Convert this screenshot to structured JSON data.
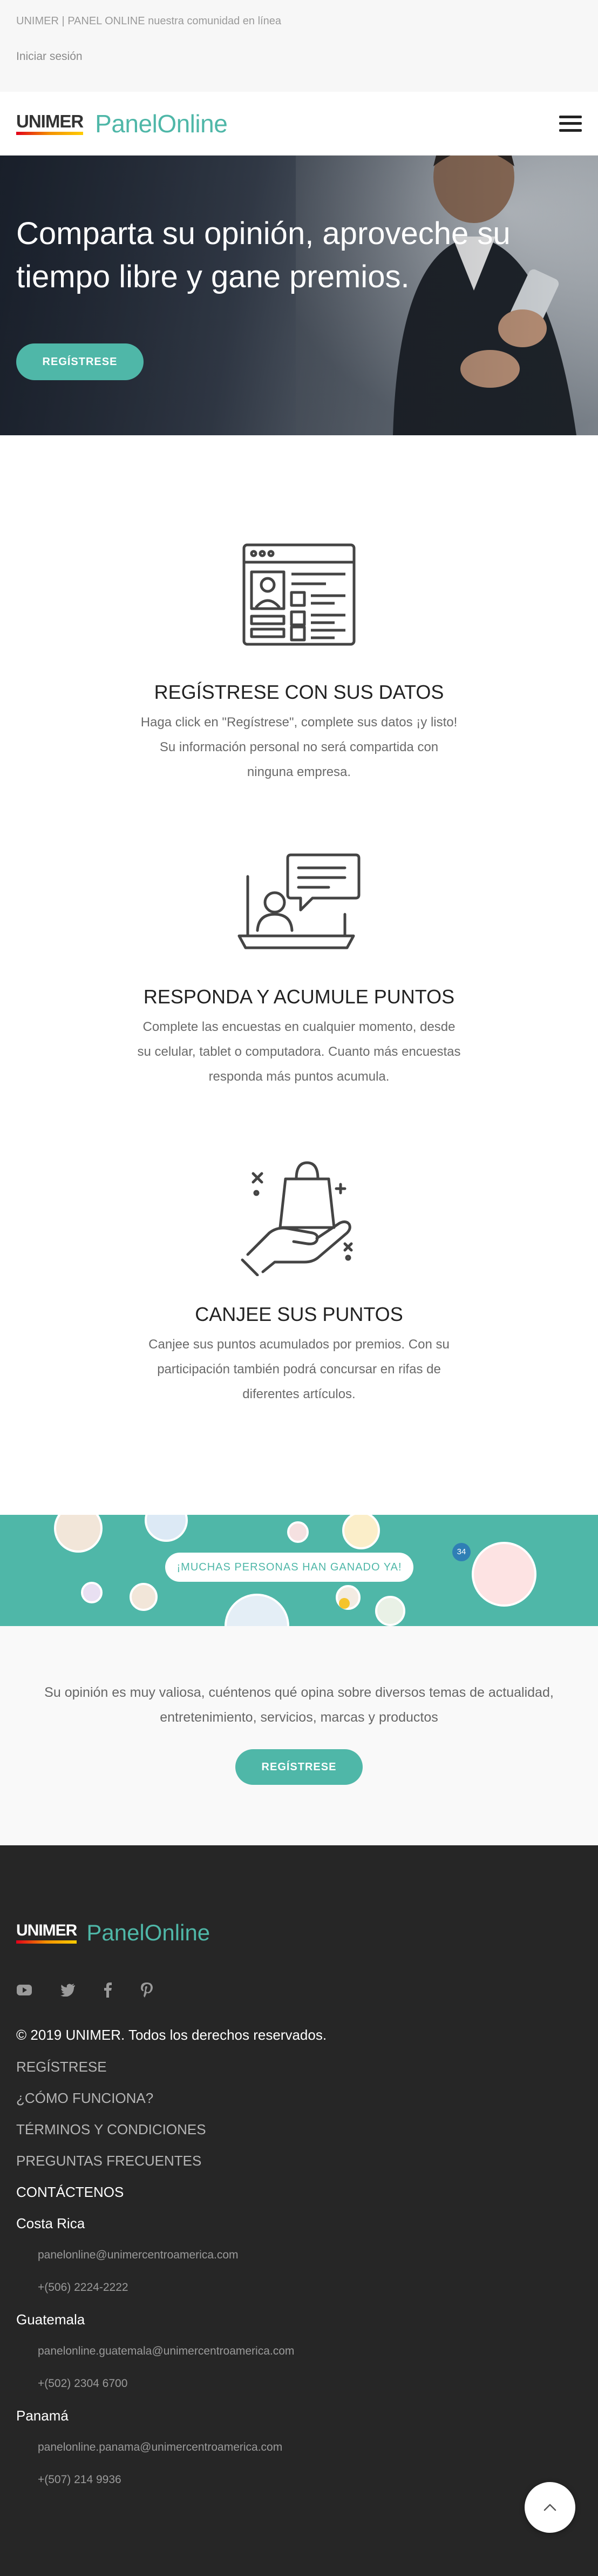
{
  "topbar": {
    "tagline": "UNIMER | PANEL ONLINE nuestra comunidad en línea",
    "login": "Iniciar sesión"
  },
  "header": {
    "logo_brand": "UNIMER",
    "logo_product": "PanelOnline",
    "menu_icon": "hamburger-menu-icon"
  },
  "hero": {
    "title": "Comparta su opinión, aproveche su tiempo libre y gane premios.",
    "button": "REGÍSTRESE"
  },
  "features": [
    {
      "icon": "registration-form-icon",
      "title": "REGÍSTRESE CON SUS DATOS",
      "text": "Haga click en \"Regístrese\", complete sus datos ¡y listo! Su información personal no será compartida con ninguna empresa."
    },
    {
      "icon": "laptop-chat-icon",
      "title": "RESPONDA Y ACUMULE PUNTOS",
      "text": "Complete las encuestas en cualquier momento, desde su celular, tablet o computadora. Cuanto más encuestas responda más puntos acumula."
    },
    {
      "icon": "hand-gift-bag-icon",
      "title": "CANJEE SUS PUNTOS",
      "text": "Canjee sus puntos acumulados por premios. Con su participación también podrá concursar en rifas de diferentes artículos."
    }
  ],
  "banner": {
    "text": "¡MUCHAS PERSONAS HAN GANADO YA!",
    "badge": "34"
  },
  "cta": {
    "text": "Su opinión es muy valiosa, cuéntenos qué opina sobre diversos temas de actualidad, entretenimiento, servicios, marcas y productos",
    "button": "REGÍSTRESE"
  },
  "footer": {
    "logo_brand": "UNIMER",
    "logo_product": "PanelOnline",
    "social": [
      "youtube-icon",
      "twitter-icon",
      "facebook-icon",
      "pinterest-icon"
    ],
    "copyright": "© 2019 UNIMER. Todos los derechos reservados.",
    "links": [
      "REGÍSTRESE",
      "¿CÓMO FUNCIONA?",
      "TÉRMINOS Y CONDICIONES",
      "PREGUNTAS FRECUENTES"
    ],
    "contact_heading": "CONTÁCTENOS",
    "offices": [
      {
        "country": "Costa Rica",
        "email": "panelonline@unimercentroamerica.com",
        "phone": "+(506) 2224-2222"
      },
      {
        "country": "Guatemala",
        "email": "panelonline.guatemala@unimercentroamerica.com",
        "phone": "+(502) 2304 6700"
      },
      {
        "country": "Panamá",
        "email": "panelonline.panama@unimercentroamerica.com",
        "phone": "+(507) 214 9936"
      }
    ]
  },
  "colors": {
    "accent": "#4fb7a8",
    "footer_bg": "#262626",
    "text_dark": "#222222"
  }
}
